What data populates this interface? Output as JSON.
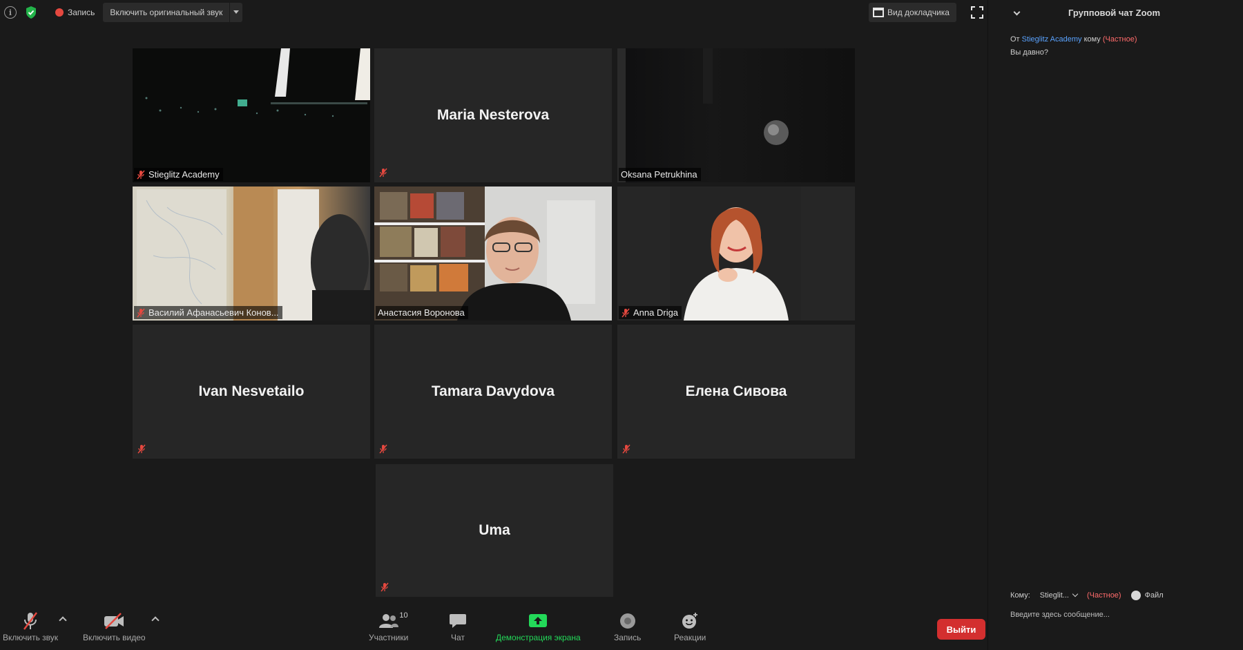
{
  "topbar": {
    "record_label": "Запись",
    "original_sound_label": "Включить оригинальный звук",
    "view_label": "Вид докладчика"
  },
  "tiles": [
    {
      "name": "Stieglitz Academy",
      "type": "video",
      "scene": "dark"
    },
    {
      "name": "Maria Nesterova",
      "type": "name"
    },
    {
      "name": "Oksana Petrukhina",
      "type": "video",
      "scene": "wall"
    },
    {
      "name": "Василий Афанасьевич Конов...",
      "type": "video",
      "scene": "room"
    },
    {
      "name": "Анастасия Воронова",
      "type": "video",
      "scene": "office",
      "active": true
    },
    {
      "name": "Anna Driga",
      "type": "video",
      "scene": "portrait"
    },
    {
      "name": "Ivan Nesvetailo",
      "type": "name"
    },
    {
      "name": "Tamara Davydova",
      "type": "name"
    },
    {
      "name": "Елена Сивова",
      "type": "name"
    },
    {
      "name": "Uma",
      "type": "name"
    }
  ],
  "toolbar": {
    "audio_label": "Включить звук",
    "video_label": "Включить видео",
    "participants_label": "Участники",
    "participants_count": "10",
    "chat_label": "Чат",
    "share_label": "Демонстрация экрана",
    "record_label": "Запись",
    "reactions_label": "Реакции",
    "leave_label": "Выйти"
  },
  "chat": {
    "title": "Групповой чат Zoom",
    "message": {
      "prefix": "От",
      "from": "Stieglitz Academy",
      "to_word": "кому",
      "private": "(Частное)",
      "text": "Вы давно?"
    },
    "compose": {
      "to_label": "Кому:",
      "to_value": "Stieglit...",
      "private": "(Частное)",
      "file_label": "Файл",
      "placeholder": "Введите здесь сообщение..."
    }
  },
  "colors": {
    "background": "#1a1a1a",
    "tile": "#262626",
    "active_speaker": "#e6e63a",
    "share_green": "#23d959",
    "leave_red": "#d32f2f",
    "mute_red": "#e5483f",
    "chat_link": "#5aa3ff"
  },
  "icons": [
    "info-icon",
    "shield-check-icon",
    "record-icon",
    "speaker-view-icon",
    "fullscreen-icon",
    "mic-muted-icon",
    "camera-off-icon",
    "participants-icon",
    "chat-icon",
    "share-screen-icon",
    "record-toolbar-icon",
    "reactions-icon",
    "file-icon"
  ]
}
